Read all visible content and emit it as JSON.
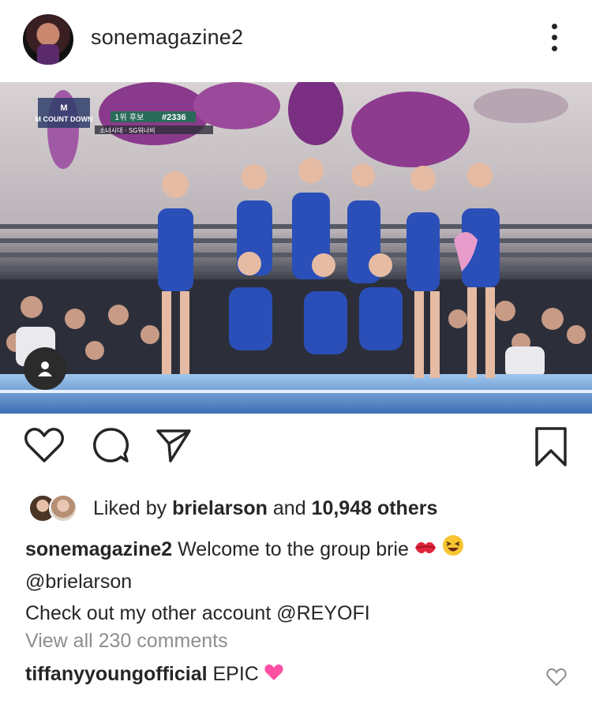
{
  "post": {
    "username": "sonemagazine2",
    "more_icon": "more-vertical-icon"
  },
  "photo": {
    "broadcast_logo": "M COUNT DOWN",
    "banner_rank": "1위 후보",
    "banner_number": "#2336",
    "banner_sub": "소녀시대 · SG워너비"
  },
  "actions": {
    "like_icon": "heart-icon",
    "comment_icon": "comment-icon",
    "share_icon": "send-icon",
    "save_icon": "bookmark-icon"
  },
  "likes": {
    "prefix": "Liked by ",
    "user": "brielarson",
    "middle": " and ",
    "count": "10,948 others"
  },
  "caption": {
    "username": "sonemagazine2",
    "text": " Welcome to the group brie",
    "line2": "@brielarson",
    "line3": "Check out my other account @REYOFI"
  },
  "comments": {
    "view_all": "View all 230 comments",
    "first_user": "tiffanyyoungofficial",
    "first_text": " EPIC"
  },
  "colors": {
    "text": "#262626",
    "muted": "#8e8e8e",
    "heart_pink": "#ff4fa3",
    "stage_blue": "#2b4fb8"
  }
}
